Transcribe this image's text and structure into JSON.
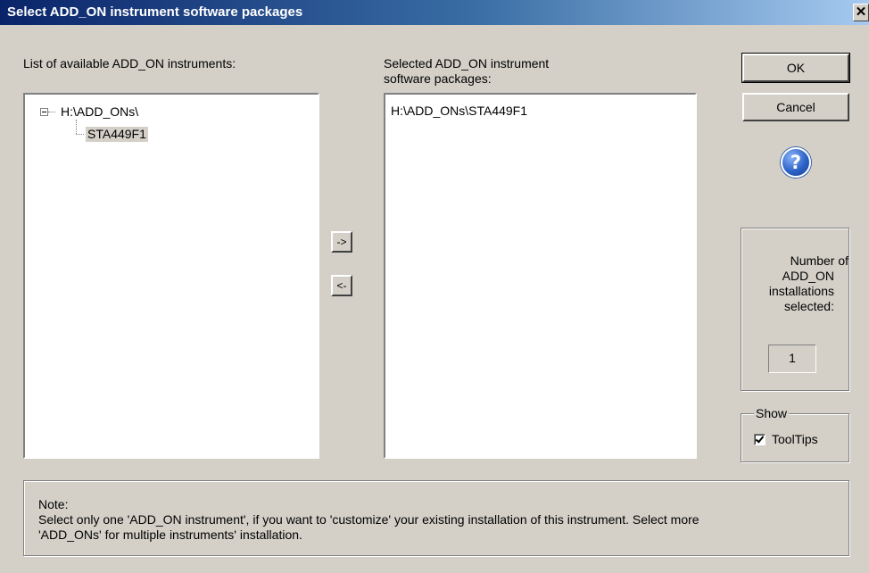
{
  "window": {
    "title": "Select ADD_ON instrument software packages",
    "close_glyph": "✕"
  },
  "available": {
    "label": "List of available ADD_ON instruments:",
    "tree": {
      "root": "H:\\ADD_ONs\\",
      "child": "STA449F1",
      "root_expander": "minus"
    }
  },
  "move": {
    "add_label": "->",
    "remove_label": "<-"
  },
  "selected": {
    "label_line1": "Selected ADD_ON instrument",
    "label_line2": "software packages:",
    "items": [
      "H:\\ADD_ONs\\STA449F1"
    ]
  },
  "buttons": {
    "ok": "OK",
    "cancel": "Cancel",
    "help_glyph": "?"
  },
  "count": {
    "line1": "Number of",
    "line2": "ADD_ON",
    "line3": "installations",
    "line4": "selected:",
    "value": "1"
  },
  "show": {
    "group_label": "Show",
    "tooltips_label": "ToolTips",
    "tooltips_checked": true
  },
  "note": {
    "title": "Note:",
    "line1": "Select only one 'ADD_ON instrument', if you want to 'customize' your existing installation of this instrument. Select more",
    "line2": "'ADD_ONs' for multiple instruments' installation."
  },
  "colors": {
    "face": "#d4d0c8",
    "title_start": "#0a246a",
    "title_end": "#a6caf0",
    "selection": "#d4d0c8"
  },
  "icons": {
    "help": "help-question-icon",
    "close": "close-icon",
    "tree_expander": "tree-collapse-icon",
    "checkbox": "checkbox-checked-icon"
  }
}
